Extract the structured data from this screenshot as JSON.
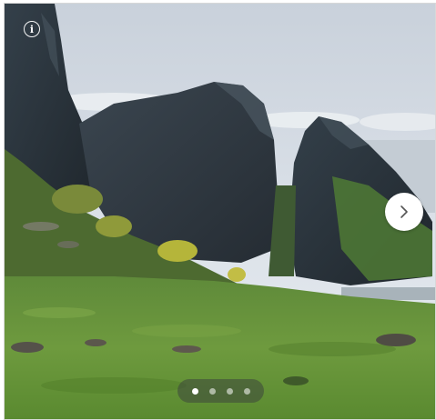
{
  "carousel": {
    "image": {
      "subject": "landscape-photo-cliffs-and-meadow"
    },
    "info_button": {
      "icon": "info-icon",
      "glyph": "i"
    },
    "next_button": {
      "icon": "chevron-right-icon"
    },
    "pagination": {
      "total": 4,
      "active_index": 0
    }
  }
}
